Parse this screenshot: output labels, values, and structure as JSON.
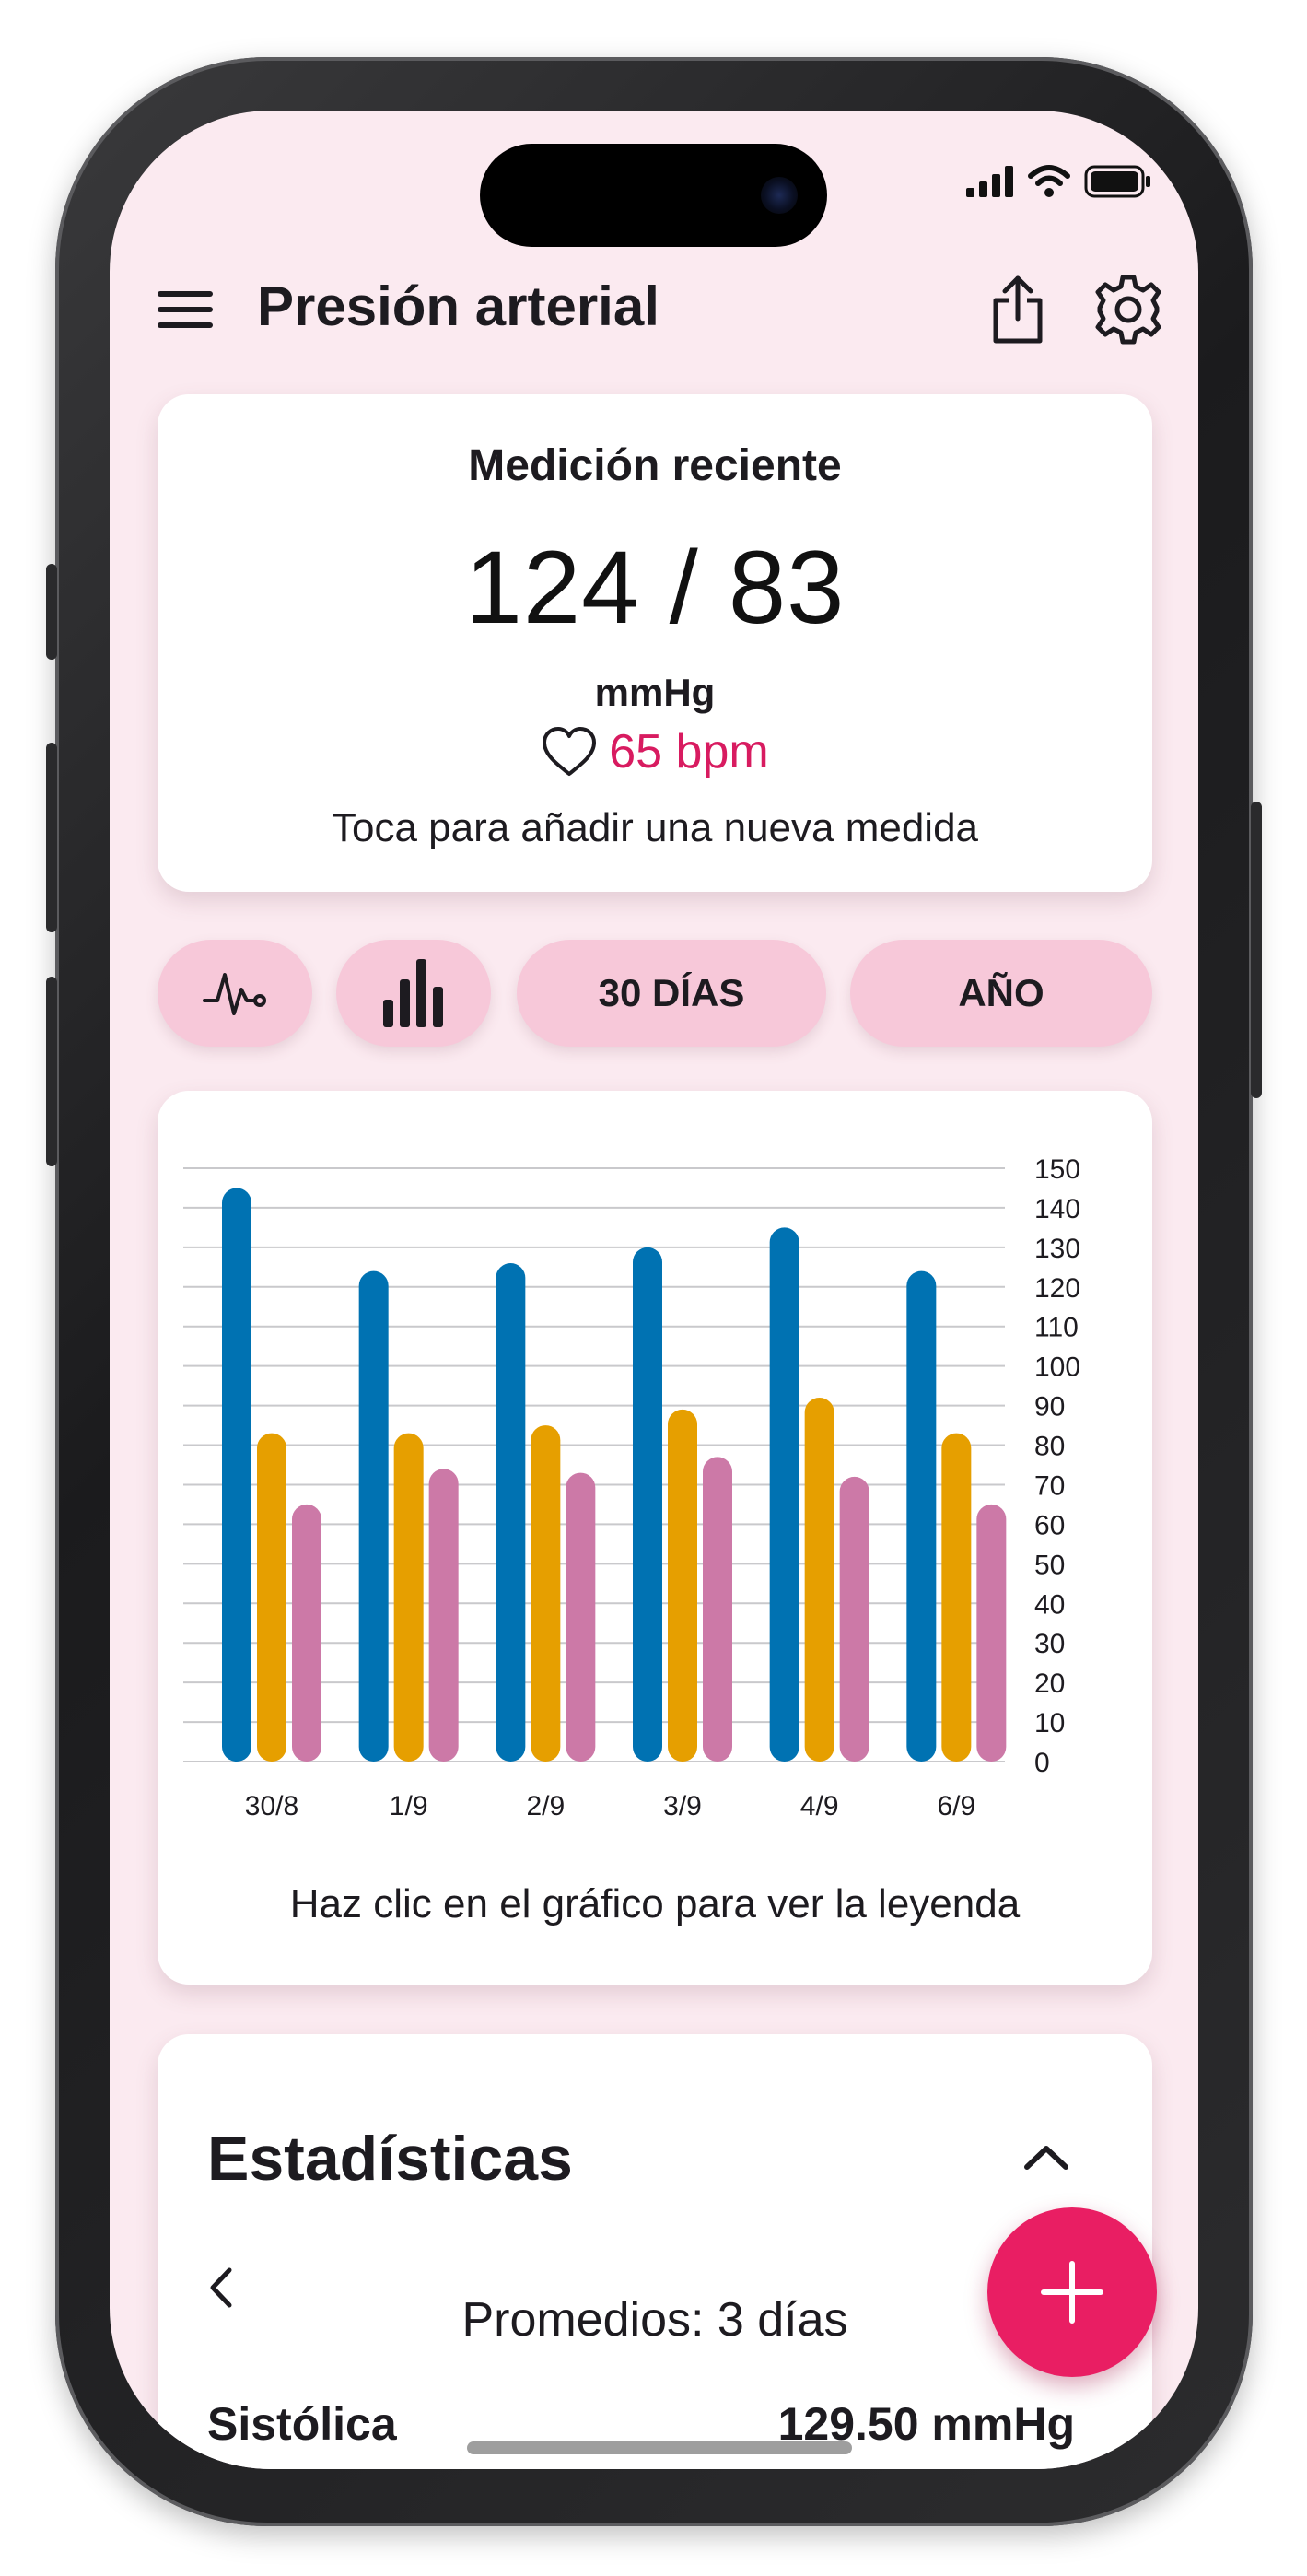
{
  "app": {
    "title": "Presión arterial"
  },
  "icons": {
    "menu": "hamburger-menu-icon",
    "share": "share-icon",
    "settings": "gear-icon",
    "heart": "heart-outline-icon",
    "line_chart": "heart-rate-line-icon",
    "bar_chart": "bar-chart-icon",
    "collapse": "chevron-up-icon",
    "prev": "chevron-left-icon",
    "add": "plus-icon"
  },
  "recent": {
    "heading": "Medición reciente",
    "value": "124 / 83",
    "unit": "mmHg",
    "pulse": "65 bpm",
    "hint": "Toca para añadir una nueva medida"
  },
  "filters": {
    "days_label": "30 DÍAS",
    "year_label": "AÑO"
  },
  "chart_hint": "Haz clic en el gráfico para ver la leyenda",
  "chart_data": {
    "type": "bar",
    "categories": [
      "30/8",
      "1/9",
      "2/9",
      "3/9",
      "4/9",
      "6/9"
    ],
    "series": [
      {
        "values": [
          145,
          124,
          126,
          130,
          135,
          124
        ]
      },
      {
        "values": [
          83,
          83,
          85,
          89,
          92,
          83
        ]
      },
      {
        "values": [
          65,
          74,
          73,
          77,
          72,
          65
        ]
      }
    ],
    "colors": [
      "#0072b2",
      "#e69f00",
      "#cc79a7"
    ],
    "ylim": [
      0,
      150
    ],
    "yticks": [
      0,
      10,
      20,
      30,
      40,
      50,
      60,
      70,
      80,
      90,
      100,
      110,
      120,
      130,
      140,
      150
    ],
    "grid": true,
    "xlabel": "",
    "ylabel": ""
  },
  "stats": {
    "heading": "Estadísticas",
    "averages_label": "Promedios: 3 días",
    "systolic_label": "Sistólica",
    "systolic_value": "129.50 mmHg"
  }
}
